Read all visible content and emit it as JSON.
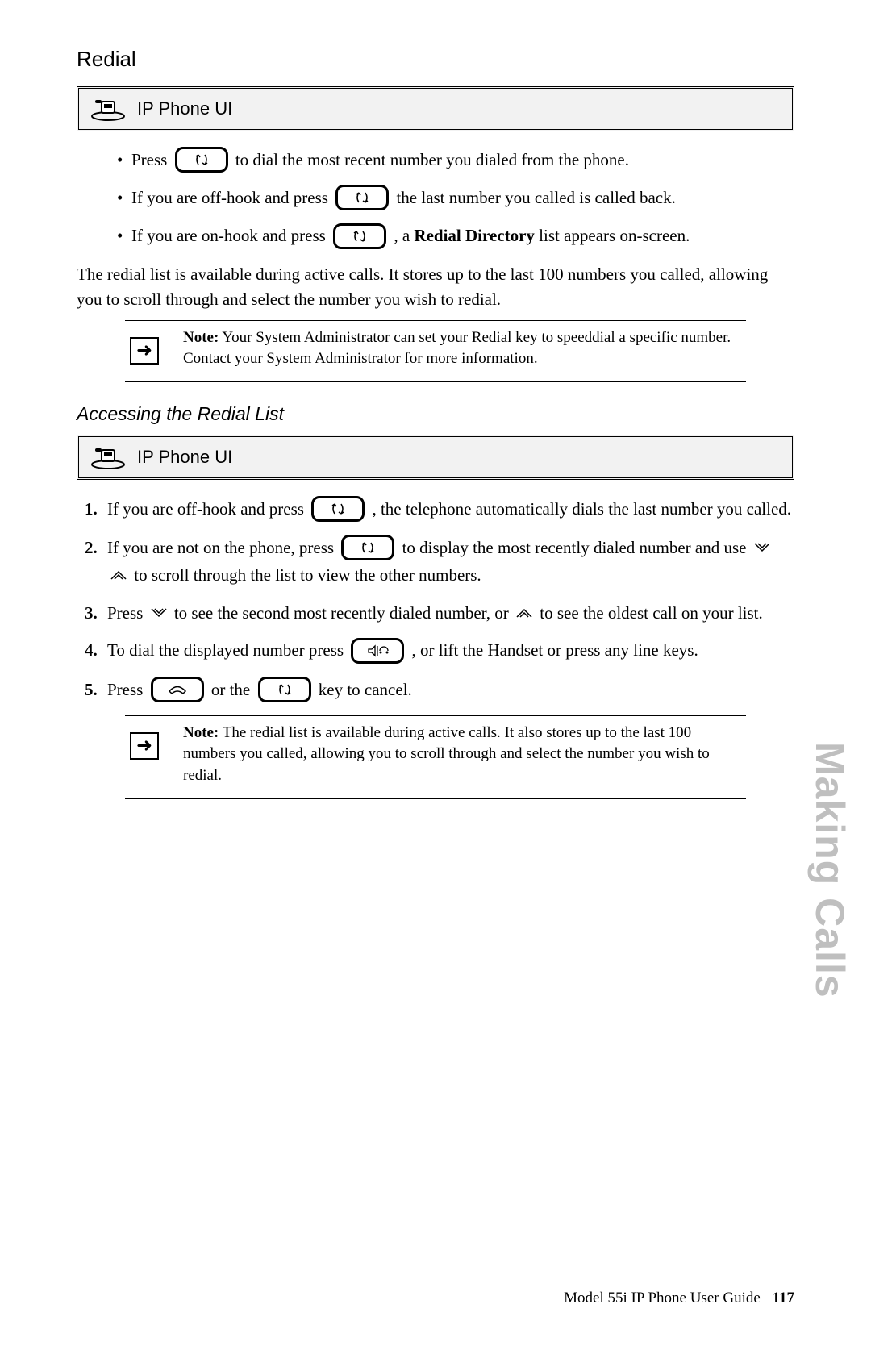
{
  "heading1": "Redial",
  "ui_label": "IP Phone UI",
  "bullets": {
    "b1a": "Press ",
    "b1b": " to dial the most recent number you dialed from the phone.",
    "b2a": "If you are off-hook and press ",
    "b2b": " the last number you called is called back.",
    "b3a": "If you are on-hook and press ",
    "b3b": ", a ",
    "b3bold": "Redial Directory",
    "b3c": " list appears on-screen."
  },
  "para1": "The redial list is available during active calls. It stores up to the last 100 numbers you called, allowing you to scroll through and select the number you wish to redial.",
  "note1_lead": "Note:",
  "note1_body": " Your System Administrator can set your Redial key to speeddial a specific number. Contact your System Administrator for more information.",
  "heading2": "Accessing the Redial List",
  "steps": {
    "s1a": "If you are off-hook and press ",
    "s1b": ", the telephone automatically dials the last number you called.",
    "s2a": "If you are not on the phone, press ",
    "s2b": " to display the most recently dialed number and use ",
    "s2c": " to scroll through the list to view the other numbers.",
    "s3a": "Press ",
    "s3b": " to see the second most recently dialed number, or ",
    "s3c": " to see the oldest call on your list.",
    "s4a": "To dial the displayed number press ",
    "s4b": ", or lift the Handset or press any line keys.",
    "s5a": "Press ",
    "s5b": " or the ",
    "s5c": " key to cancel."
  },
  "note2_lead": "Note:",
  "note2_body": " The redial list is available during active calls. It also stores up to the last 100 numbers you called, allowing you to scroll through and select the number you wish to redial.",
  "side_tab": "Making Calls",
  "footer_text": "Model 55i IP Phone User Guide",
  "page_number": "117",
  "icons": {
    "redial": "redial-key",
    "down": "down-arrow-key",
    "up": "up-arrow-key",
    "speaker": "speaker-headset-key",
    "goodbye": "goodbye-key"
  }
}
